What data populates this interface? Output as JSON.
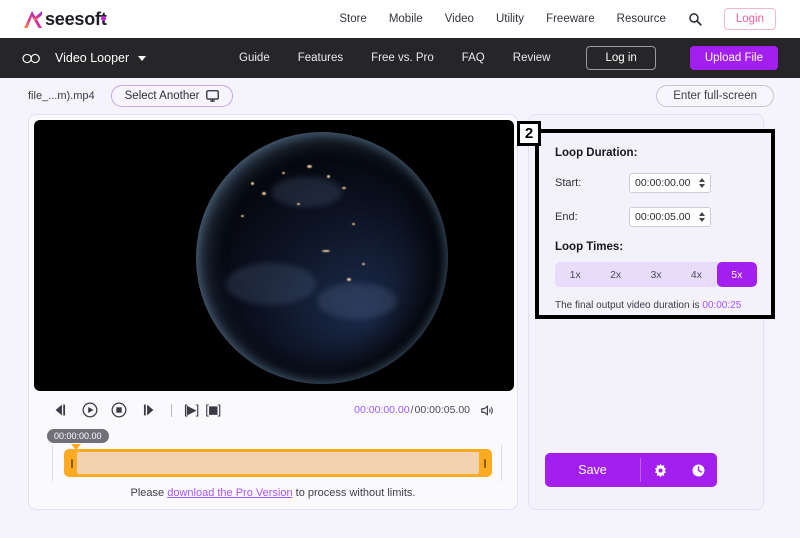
{
  "brand": {
    "name_prefix": "A",
    "name": "seesoft",
    "accent": "#a21ff0"
  },
  "top_nav": {
    "items": [
      {
        "label": "Store"
      },
      {
        "label": "Mobile"
      },
      {
        "label": "Video"
      },
      {
        "label": "Utility"
      },
      {
        "label": "Freeware"
      },
      {
        "label": "Resource"
      }
    ],
    "search_icon": "search-icon",
    "login_label": "Login"
  },
  "app_bar": {
    "product_icon": "infinity-icon",
    "product_name": "Video Looper",
    "dropdown_icon": "chevron-down-icon",
    "nav": [
      {
        "label": "Guide"
      },
      {
        "label": "Features"
      },
      {
        "label": "Free vs. Pro"
      },
      {
        "label": "FAQ"
      },
      {
        "label": "Review"
      }
    ],
    "login_label": "Log in",
    "upload_label": "Upload File"
  },
  "file_bar": {
    "filename": "file_...m).mp4",
    "select_another_label": "Select Another",
    "select_another_icon": "monitor-icon",
    "fullscreen_label": "Enter full-screen"
  },
  "player": {
    "controls": [
      {
        "name": "rewind-icon"
      },
      {
        "name": "play-icon"
      },
      {
        "name": "stop-icon"
      },
      {
        "name": "forward-icon"
      }
    ],
    "mark_start_label": "[▶]",
    "mark_end_label": "[◼]",
    "current_time": "00:00:00.00",
    "separator": "/",
    "total_time": "00:00:05.00",
    "volume_icon": "volume-icon",
    "timeline_tooltip": "00:00:00.00"
  },
  "pro_note": {
    "before": "Please ",
    "link": "download the Pro Version",
    "after": " to process without limits."
  },
  "panel": {
    "step_badge": "2",
    "loop_duration_title": "Loop Duration:",
    "start_label": "Start:",
    "start_value": "00:00:00.00",
    "end_label": "End:",
    "end_value": "00:00:05.00",
    "loop_times_title": "Loop Times:",
    "loop_options": [
      {
        "label": "1x",
        "active": false
      },
      {
        "label": "2x",
        "active": false
      },
      {
        "label": "3x",
        "active": false
      },
      {
        "label": "4x",
        "active": false
      },
      {
        "label": "5x",
        "active": true
      }
    ],
    "final_note_text": "The final output video duration is ",
    "final_note_value": "00:00:25",
    "save_label": "Save",
    "settings_icon": "gear-icon",
    "history_icon": "clock-icon"
  }
}
